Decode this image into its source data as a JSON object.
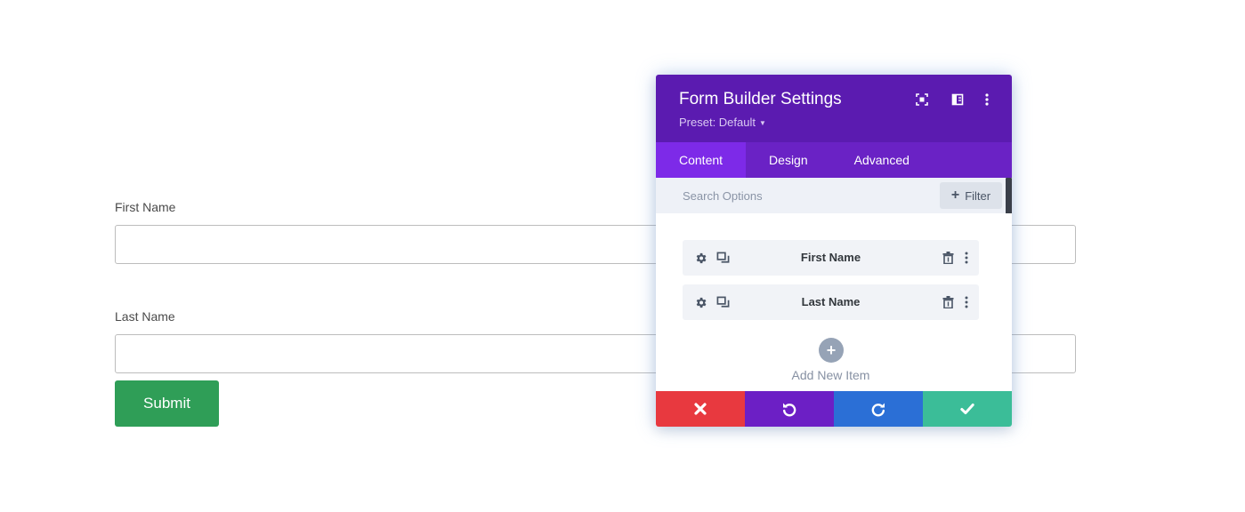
{
  "form": {
    "fields": [
      {
        "label": "First Name",
        "value": ""
      },
      {
        "label": "Last Name",
        "value": ""
      }
    ],
    "submit_label": "Submit"
  },
  "modal": {
    "title": "Form Builder Settings",
    "preset": "Preset: Default",
    "tabs": [
      {
        "label": "Content",
        "active": true
      },
      {
        "label": "Design",
        "active": false
      },
      {
        "label": "Advanced",
        "active": false
      }
    ],
    "search": {
      "placeholder": "Search Options",
      "value": ""
    },
    "filter_label": "Filter",
    "items": [
      {
        "label": "First Name"
      },
      {
        "label": "Last Name"
      }
    ],
    "add_item_label": "Add New Item"
  },
  "colors": {
    "header": "#5b1bb0",
    "tabs": "#6a22c5",
    "active_tab": "#7d2ae8",
    "submit": "#2f9e57",
    "cancel": "#e8393f",
    "undo": "#6c1fc5",
    "redo": "#2b6fd6",
    "save": "#3bbd98"
  },
  "icons": {
    "header": [
      "expand-icon",
      "split-view-icon",
      "more-vertical-icon"
    ],
    "row": [
      "gear-icon",
      "duplicate-icon",
      "trash-icon",
      "more-vertical-icon"
    ],
    "footer": [
      "close-icon",
      "undo-icon",
      "redo-icon",
      "check-icon"
    ]
  }
}
